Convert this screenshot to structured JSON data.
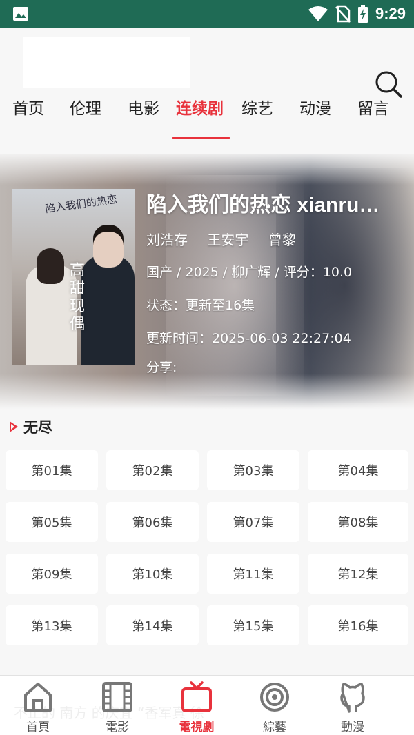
{
  "status_bar": {
    "time": "9:29"
  },
  "nav": {
    "tabs": [
      {
        "label": "首页"
      },
      {
        "label": "伦理"
      },
      {
        "label": "电影"
      },
      {
        "label": "连续剧",
        "active": true
      },
      {
        "label": "综艺"
      },
      {
        "label": "动漫"
      },
      {
        "label": "留言"
      }
    ]
  },
  "detail": {
    "title": "陷入我们的热恋 xianru…",
    "cast": [
      "刘浩存",
      "王安宇",
      "曾黎"
    ],
    "meta": "国产 / 2025 / 柳广辉 / 评分：10.0",
    "status": "状态：更新至16集",
    "updated": "更新时间：2025-06-03 22:27:04",
    "share": "分享:",
    "poster": {
      "script_text": "陷入我们的热恋",
      "vertical_text": "高甜现偶"
    }
  },
  "source": {
    "name": "无尽"
  },
  "episodes": [
    "第01集",
    "第02集",
    "第03集",
    "第04集",
    "第05集",
    "第06集",
    "第07集",
    "第08集",
    "第09集",
    "第10集",
    "第11集",
    "第12集",
    "第13集",
    "第14集",
    "第15集",
    "第16集"
  ],
  "bottom_bar": {
    "tabs": [
      {
        "label": "首頁",
        "icon": "home-icon"
      },
      {
        "label": "電影",
        "icon": "film-icon"
      },
      {
        "label": "電視劇",
        "icon": "tv-icon",
        "active": true
      },
      {
        "label": "綜藝",
        "icon": "target-icon"
      },
      {
        "label": "動漫",
        "icon": "github-cat-icon"
      }
    ],
    "ghost_text": "不止的 南方 的庆宜 “香军真 徐"
  },
  "colors": {
    "accent": "#e8323c",
    "status_bar": "#1f6b55"
  }
}
